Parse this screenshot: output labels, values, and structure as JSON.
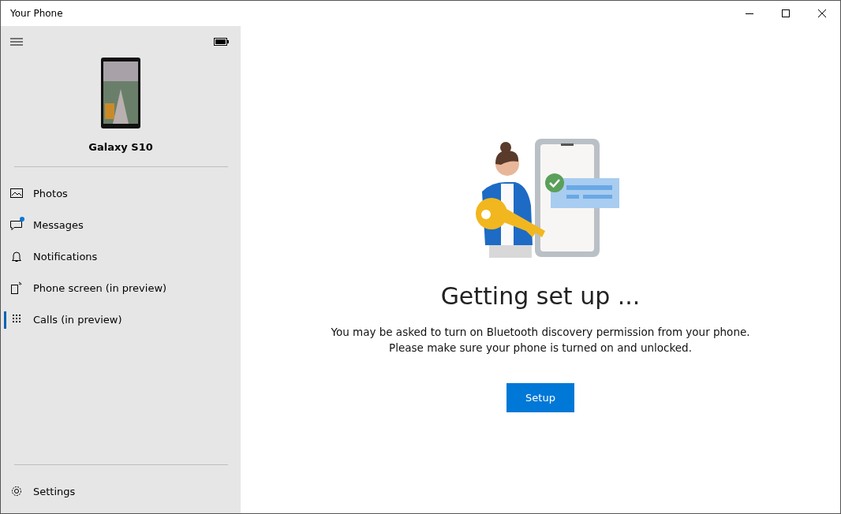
{
  "window": {
    "title": "Your Phone"
  },
  "sidebar": {
    "device_name": "Galaxy S10",
    "items": [
      {
        "kind": "photos",
        "label": "Photos",
        "selected": false,
        "badge": false
      },
      {
        "kind": "messages",
        "label": "Messages",
        "selected": false,
        "badge": true
      },
      {
        "kind": "notifications",
        "label": "Notifications",
        "selected": false,
        "badge": false
      },
      {
        "kind": "screen",
        "label": "Phone screen (in preview)",
        "selected": false,
        "badge": false
      },
      {
        "kind": "calls",
        "label": "Calls (in preview)",
        "selected": true,
        "badge": false
      }
    ],
    "settings": {
      "label": "Settings"
    }
  },
  "main": {
    "heading": "Getting set up ...",
    "lines": [
      "You may be asked to turn on Bluetooth discovery permission from your phone.",
      "Please make sure your phone is turned on and unlocked."
    ],
    "button": "Setup"
  }
}
